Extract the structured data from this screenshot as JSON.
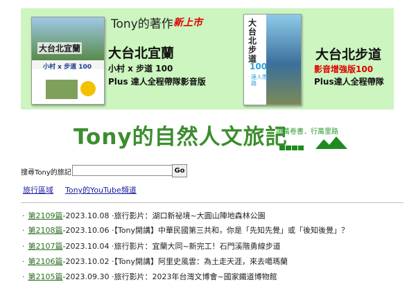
{
  "banner": {
    "announcement": "Tony的著作",
    "announcement_new": "新上市",
    "book1": {
      "cover_title": "大台北宜蘭",
      "cover_sub": "小村 x 步道 100",
      "title": "大台北宜蘭",
      "subtitle": "小村 x 步道 100",
      "plus": "Plus 達人全程帶隊影音版"
    },
    "book2": {
      "cover_title": "大台北步道",
      "cover_hundred": "100",
      "cover_text": "達人帶路",
      "title": "大台北步道",
      "subtitle": "影音增強版100",
      "plus": "Plus達人全程帶隊"
    }
  },
  "logo": {
    "text": "Tony的自然人文旅記",
    "tagline": "讀萬卷書．行萬里路"
  },
  "search": {
    "label": "搜尋Tony的旅記：",
    "value": "",
    "button": "Go"
  },
  "nav": {
    "link1": "旅行區域",
    "link2": "Tony的YouTube頻道"
  },
  "articles": [
    {
      "num": "第2109篇",
      "date": "-2023.10.08",
      "text": " ‧旅行影片：湖口新祕境~大圓山陣地森林公園"
    },
    {
      "num": "第2108篇",
      "date": "-2023.10.06",
      "text": " ‧【Tony開講】中華民國第三共和，你是「先知先覺」或「後知後覺」？"
    },
    {
      "num": "第2107篇",
      "date": "-2023.10.04",
      "text": " ‧旅行影片：宜蘭大同~新完工！石門溪階勇線步道"
    },
    {
      "num": "第2106篇",
      "date": "-2023.10.02",
      "text": " ‧【Tony開講】阿里史風雲：為土走天涯，來去噶瑪蘭"
    },
    {
      "num": "第2105篇",
      "date": "-2023.09.30",
      "text": " ‧旅行影片：2023年台灣文博會~國家鐵道博物館"
    }
  ]
}
